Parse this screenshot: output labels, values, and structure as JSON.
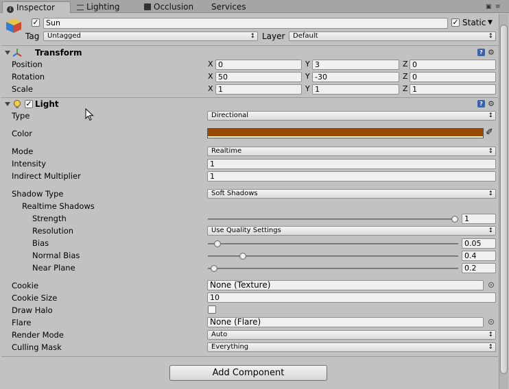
{
  "tabs": [
    {
      "label": "Inspector",
      "icon": "info-icon"
    },
    {
      "label": "Lighting",
      "icon": "lighting-icon"
    },
    {
      "label": "Occlusion",
      "icon": "occlusion-icon"
    },
    {
      "label": "Services",
      "icon": ""
    }
  ],
  "header": {
    "name": "Sun",
    "active": true,
    "static_label": "Static",
    "static": true,
    "tag_label": "Tag",
    "tag_value": "Untagged",
    "layer_label": "Layer",
    "layer_value": "Default"
  },
  "transform": {
    "title": "Transform",
    "rows": [
      {
        "label": "Position",
        "x": "0",
        "y": "3",
        "z": "0"
      },
      {
        "label": "Rotation",
        "x": "50",
        "y": "-30",
        "z": "0"
      },
      {
        "label": "Scale",
        "x": "1",
        "y": "1",
        "z": "1"
      }
    ],
    "axis_x": "X",
    "axis_y": "Y",
    "axis_z": "Z"
  },
  "light": {
    "title": "Light",
    "enabled": true,
    "type_label": "Type",
    "type_value": "Directional",
    "color_label": "Color",
    "color_value": "#9a4a00",
    "mode_label": "Mode",
    "mode_value": "Realtime",
    "intensity_label": "Intensity",
    "intensity_value": "1",
    "indirect_label": "Indirect Multiplier",
    "indirect_value": "1",
    "shadow_type_label": "Shadow Type",
    "shadow_type_value": "Soft Shadows",
    "realtime_shadows_label": "Realtime Shadows",
    "strength_label": "Strength",
    "strength_value": "1",
    "strength_level": 1.0,
    "resolution_label": "Resolution",
    "resolution_value": "Use Quality Settings",
    "bias_label": "Bias",
    "bias_value": "0.05",
    "bias_level": 0.025,
    "normal_bias_label": "Normal Bias",
    "normal_bias_value": "0.4",
    "normal_bias_level": 0.13,
    "near_plane_label": "Near Plane",
    "near_plane_value": "0.2",
    "near_plane_level": 0.01,
    "cookie_label": "Cookie",
    "cookie_value": "None (Texture)",
    "cookie_size_label": "Cookie Size",
    "cookie_size_value": "10",
    "draw_halo_label": "Draw Halo",
    "draw_halo": false,
    "flare_label": "Flare",
    "flare_value": "None (Flare)",
    "render_mode_label": "Render Mode",
    "render_mode_value": "Auto",
    "culling_mask_label": "Culling Mask",
    "culling_mask_value": "Everything"
  },
  "add_component_label": "Add Component",
  "colors": {
    "accent": "#3a63a8",
    "light_color": "#9a4a00"
  }
}
